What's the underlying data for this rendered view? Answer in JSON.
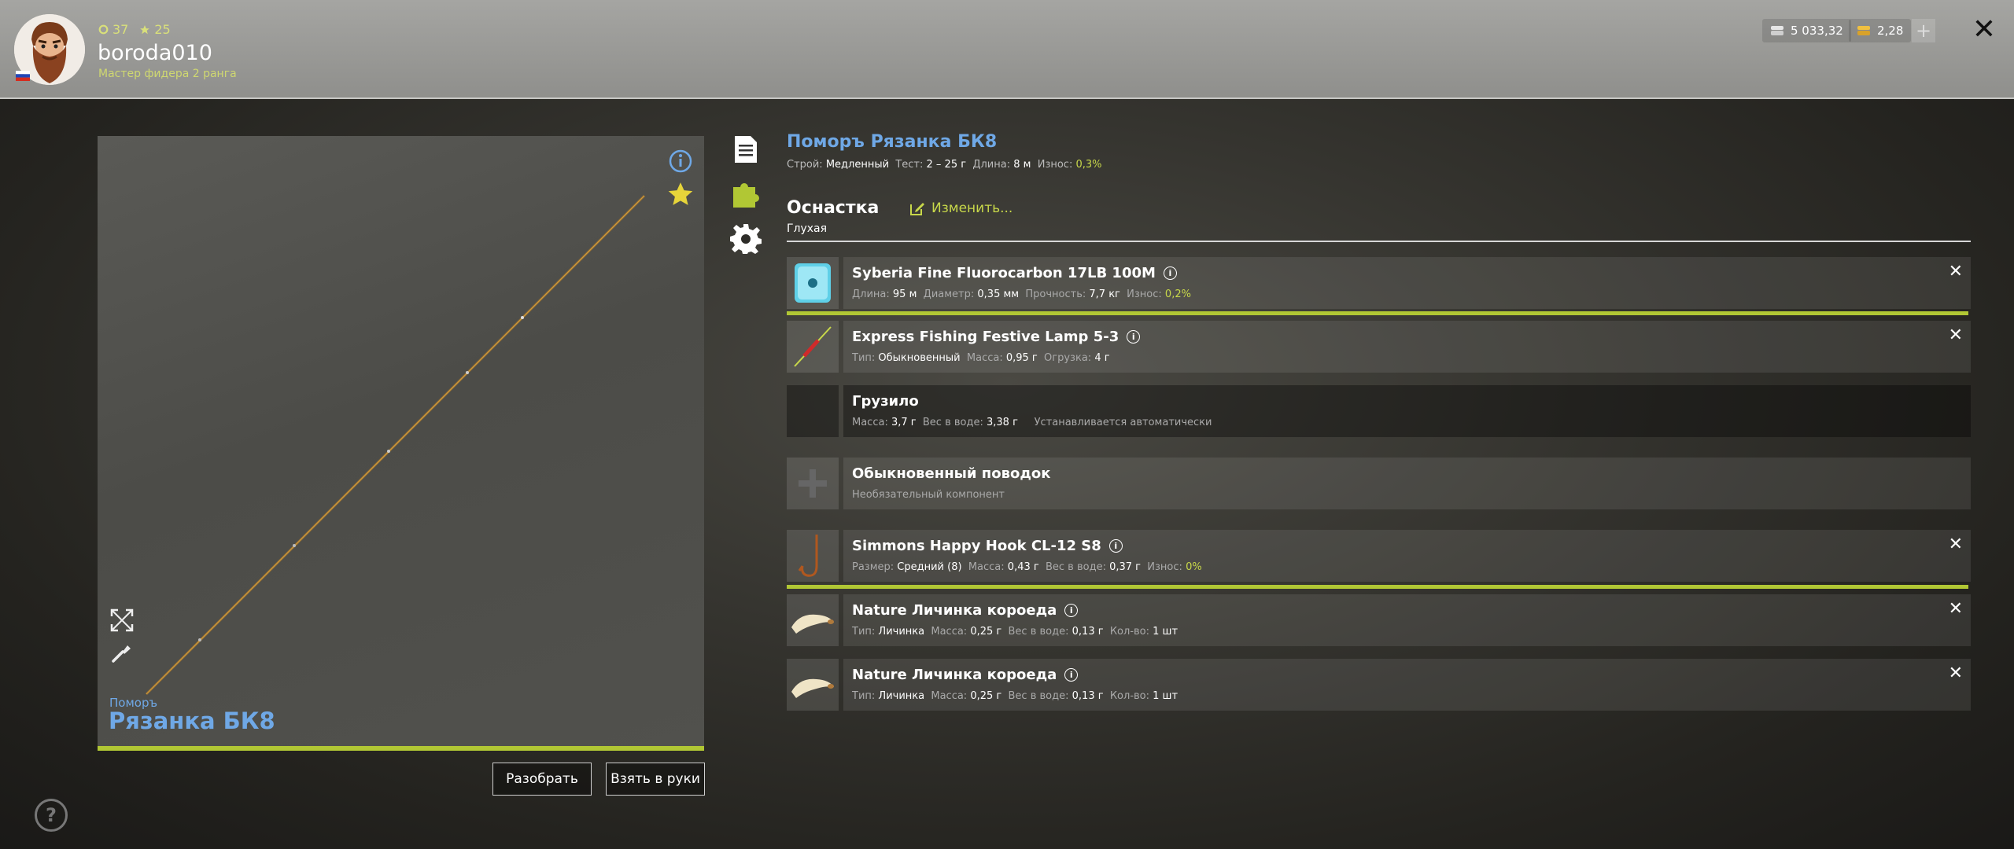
{
  "player": {
    "level": "37",
    "stars": "25",
    "username": "boroda010",
    "rank": "Мастер фидера 2 ранга"
  },
  "currency": {
    "silver": "5 033,32",
    "gold": "2,28",
    "add": "+"
  },
  "rod": {
    "brand": "Поморъ",
    "name": "Рязанка БК8",
    "full_title": "Поморъ Рязанка БК8",
    "specs": {
      "action_label": "Строй:",
      "action": "Медленный",
      "test_label": "Тест:",
      "test": "2 – 25 г",
      "length_label": "Длина:",
      "length": "8 м",
      "wear_label": "Износ:",
      "wear": "0,3%"
    }
  },
  "buttons": {
    "disassemble": "Разобрать",
    "take": "Взять в руки"
  },
  "tackle": {
    "title": "Оснастка",
    "type": "Глухая",
    "change": "Изменить..."
  },
  "items": [
    {
      "name": "Syberia Fine Fluorocarbon 17LB 100M",
      "d": [
        [
          "Длина:",
          "95 м"
        ],
        [
          "Диаметр:",
          "0,35 мм"
        ],
        [
          "Прочность:",
          "7,7 кг"
        ],
        [
          "Износ:",
          "0,2%"
        ]
      ]
    },
    {
      "name": "Express Fishing Festive Lamp 5-3",
      "d": [
        [
          "Тип:",
          "Обыкновенный"
        ],
        [
          "Масса:",
          "0,95 г"
        ],
        [
          "Огрузка:",
          "4 г"
        ]
      ]
    },
    {
      "name": "Грузило",
      "d": [
        [
          "Масса:",
          "3,7 г"
        ],
        [
          "Вес в воде:",
          "3,38 г"
        ]
      ],
      "note": "Устанавливается автоматически"
    },
    {
      "name": "Обыкновенный поводок",
      "note": "Необязательный компонент"
    },
    {
      "name": "Simmons Happy Hook CL-12 S8",
      "d": [
        [
          "Размер:",
          "Средний (8)"
        ],
        [
          "Масса:",
          "0,43 г"
        ],
        [
          "Вес в воде:",
          "0,37 г"
        ],
        [
          "Износ:",
          "0%"
        ]
      ]
    },
    {
      "name": "Nature Личинка короеда",
      "d": [
        [
          "Тип:",
          "Личинка"
        ],
        [
          "Масса:",
          "0,25 г"
        ],
        [
          "Вес в воде:",
          "0,13 г"
        ],
        [
          "Кол-во:",
          "1 шт"
        ]
      ]
    },
    {
      "name": "Nature Личинка короеда",
      "d": [
        [
          "Тип:",
          "Личинка"
        ],
        [
          "Масса:",
          "0,25 г"
        ],
        [
          "Вес в воде:",
          "0,13 г"
        ],
        [
          "Кол-во:",
          "1 шт"
        ]
      ]
    }
  ],
  "help": "?",
  "colors": {
    "accent_green": "#b1c734",
    "title_blue": "#6fa8e6"
  }
}
